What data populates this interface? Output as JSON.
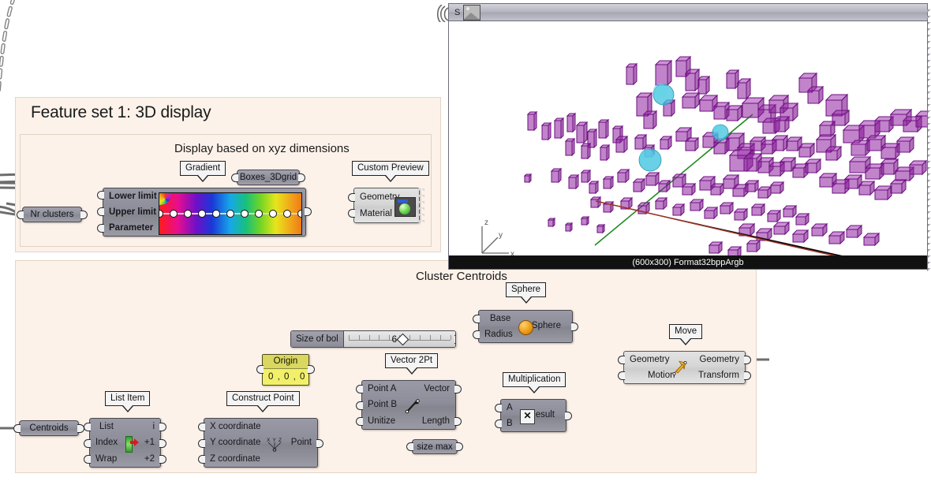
{
  "app": {
    "background": "#ffffff",
    "group_fill": "#fdf2e9"
  },
  "groups": [
    {
      "title": "Feature set 1: 3D display",
      "subtitle": "Display based on xyz dimensions"
    },
    {
      "title": "Cluster Centroids"
    }
  ],
  "feature_set_1": {
    "title": "Feature set 1: 3D display",
    "subtitle": "Display based on xyz dimensions",
    "nr_clusters": {
      "label": "Nr clusters"
    },
    "gradient": {
      "tag": "Gradient",
      "inputs": [
        "Lower limit",
        "Upper limit",
        "Parameter"
      ],
      "handle_count": 11
    },
    "boxes_3dgrid": {
      "label": "Boxes_3Dgrid"
    },
    "custom_preview": {
      "tag": "Custom Preview",
      "inputs": [
        "Geometry",
        "Material"
      ],
      "icon": "material-sphere-icon"
    }
  },
  "cluster_centroids": {
    "title": "Cluster Centroids",
    "centroids": {
      "label": "Centroids"
    },
    "list_item": {
      "tag": "List Item",
      "inputs": [
        "List",
        "Index",
        "Wrap"
      ],
      "outputs": [
        "i",
        "+1",
        "+2"
      ],
      "icon": "list-item-icon"
    },
    "construct_point": {
      "tag": "Construct Point",
      "inputs": [
        "X coordinate",
        "Y coordinate",
        "Z coordinate"
      ],
      "outputs": [
        "Point"
      ],
      "icon": "xyz-point-icon"
    },
    "origin_panel": {
      "title": "Origin",
      "value": "0 , 0 , 0",
      "color": "#f2f06a"
    },
    "size_of_ball_slider": {
      "name": "Size of bol",
      "value": "6",
      "tick_count": 11,
      "knob_position_pct": 52
    },
    "vector_2pt": {
      "tag": "Vector 2Pt",
      "inputs": [
        "Point A",
        "Point B",
        "Unitize"
      ],
      "outputs": [
        "Vector",
        "Length"
      ],
      "icon": "vector-arrow-icon"
    },
    "size_max": {
      "label": "size max"
    },
    "multiplication": {
      "tag": "Multiplication",
      "inputs": [
        "A",
        "B"
      ],
      "outputs": [
        "Result"
      ],
      "icon": "multiply-icon"
    },
    "sphere": {
      "tag": "Sphere",
      "inputs": [
        "Base",
        "Radius"
      ],
      "outputs": [
        "Sphere"
      ],
      "icon": "sphere-icon"
    },
    "move": {
      "tag": "Move",
      "inputs": [
        "Geometry",
        "Motion"
      ],
      "outputs": [
        "Geometry",
        "Transform"
      ],
      "icon": "move-arrow-icon"
    }
  },
  "viewport": {
    "title_letter": "S",
    "icon": "image-icon",
    "status": "(600x300) Format32bppArgb",
    "axis": {
      "x": "x",
      "y": "y",
      "z": "z"
    },
    "colors": {
      "box": "#8e1f9e",
      "sphere": "#3fc3df",
      "axis_line_green": "#1e8a1e",
      "axis_line_red": "#9a3326"
    }
  }
}
